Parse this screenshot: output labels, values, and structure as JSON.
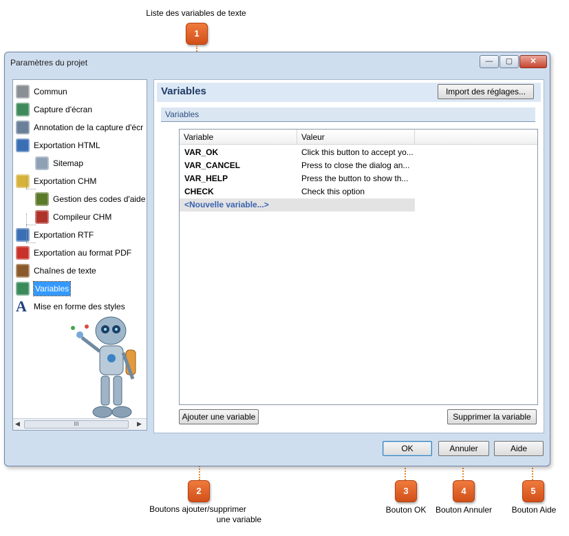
{
  "callouts": {
    "c1": {
      "number": "1",
      "label": "Liste des variables de texte"
    },
    "c2": {
      "number": "2",
      "label_line1": "Boutons ajouter/supprimer",
      "label_line2": "une variable"
    },
    "c3": {
      "number": "3",
      "label": "Bouton OK"
    },
    "c4": {
      "number": "4",
      "label": "Bouton Annuler"
    },
    "c5": {
      "number": "5",
      "label": "Bouton Aide"
    }
  },
  "window": {
    "title": "Paramètres du projet",
    "controls": {
      "minimize": "—",
      "maximize": "▢",
      "close": "✕"
    }
  },
  "tree": {
    "items": [
      {
        "label": "Commun",
        "icon": "gear-icon"
      },
      {
        "label": "Capture d'écran",
        "icon": "screen-capture-icon"
      },
      {
        "label": "Annotation de la capture d'écr",
        "icon": "annotation-gear-icon"
      },
      {
        "label": "Exportation HTML",
        "icon": "html-export-icon"
      },
      {
        "label": "Sitemap",
        "icon": "sitemap-icon"
      },
      {
        "label": "Exportation CHM",
        "icon": "chm-export-icon"
      },
      {
        "label": "Gestion des codes d'aide",
        "icon": "help-id-icon"
      },
      {
        "label": "Compileur CHM",
        "icon": "compiler-gear-icon"
      },
      {
        "label": "Exportation RTF",
        "icon": "rtf-export-icon"
      },
      {
        "label": "Exportation au format PDF",
        "icon": "pdf-export-icon"
      },
      {
        "label": "Chaînes de texte",
        "icon": "text-strings-icon"
      },
      {
        "label": "Variables",
        "icon": "variables-icon",
        "selected": true
      },
      {
        "label": "Mise en forme des styles",
        "icon": "font-a-icon"
      }
    ],
    "scroll_grip": "III"
  },
  "panel": {
    "title": "Variables",
    "import_button": "Import des réglages...",
    "section_label": "Variables",
    "columns": [
      "Variable",
      "Valeur"
    ],
    "rows": [
      {
        "name": "VAR_OK",
        "value": "Click this button to accept yo..."
      },
      {
        "name": "VAR_CANCEL",
        "value": "Press to close the dialog an..."
      },
      {
        "name": "VAR_HELP",
        "value": "Press the button to show th..."
      },
      {
        "name": "CHECK",
        "value": "Check this option"
      }
    ],
    "new_variable": "<Nouvelle variable...>",
    "add_button": "Ajouter une variable",
    "delete_button": "Supprimer la variable"
  },
  "footer": {
    "ok": "OK",
    "cancel": "Annuler",
    "help": "Aide"
  },
  "colors": {
    "callout": "#e0622a",
    "selection": "#3399ff",
    "panel_title": "#1f3b66",
    "new_variable": "#3a62b0"
  }
}
